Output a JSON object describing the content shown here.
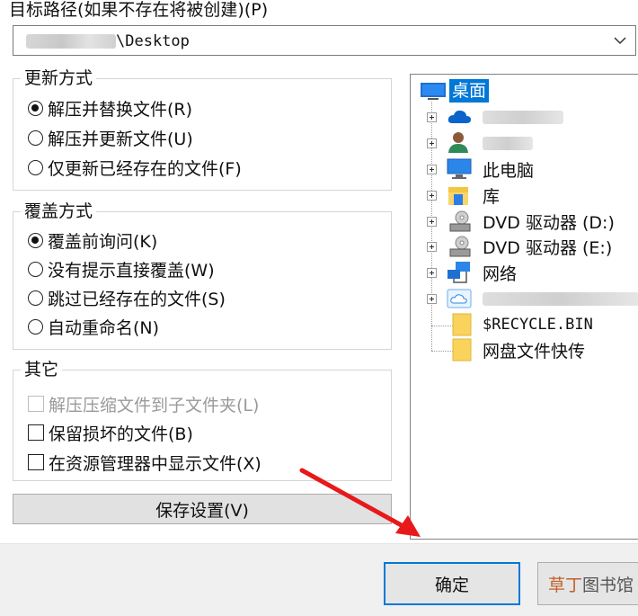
{
  "dialog": {
    "dest_label": "目标路径(如果不存在将被创建)(P)",
    "dest_path_suffix": "\\Desktop"
  },
  "update_group": {
    "title": "更新方式",
    "options": [
      {
        "label": "解压并替换文件(R)",
        "selected": true
      },
      {
        "label": "解压并更新文件(U)",
        "selected": false
      },
      {
        "label": "仅更新已经存在的文件(F)",
        "selected": false
      }
    ]
  },
  "overwrite_group": {
    "title": "覆盖方式",
    "options": [
      {
        "label": "覆盖前询问(K)",
        "selected": true
      },
      {
        "label": "没有提示直接覆盖(W)",
        "selected": false
      },
      {
        "label": "跳过已经存在的文件(S)",
        "selected": false
      },
      {
        "label": "自动重命名(N)",
        "selected": false
      }
    ]
  },
  "misc_group": {
    "title": "其它",
    "options": [
      {
        "label": "解压压缩文件到子文件夹(L)",
        "checked": false,
        "disabled": true
      },
      {
        "label": "保留损坏的文件(B)",
        "checked": false,
        "disabled": false
      },
      {
        "label": "在资源管理器中显示文件(X)",
        "checked": false,
        "disabled": false
      }
    ]
  },
  "save_settings_label": "保存设置(V)",
  "tree": {
    "root": {
      "label": "桌面",
      "icon": "desktop-icon"
    },
    "items": [
      {
        "label": "",
        "icon": "onedrive-cloud-icon",
        "expandable": true
      },
      {
        "label": "",
        "icon": "user-icon",
        "expandable": true
      },
      {
        "label": "此电脑",
        "icon": "computer-icon",
        "expandable": true
      },
      {
        "label": "库",
        "icon": "library-icon",
        "expandable": true
      },
      {
        "label": "DVD 驱动器 (D:)",
        "icon": "dvd-drive-icon",
        "expandable": true
      },
      {
        "label": "DVD 驱动器 (E:)",
        "icon": "dvd-drive-icon",
        "expandable": true
      },
      {
        "label": "网络",
        "icon": "network-icon",
        "expandable": true
      },
      {
        "label": "",
        "icon": "icloud-drive-icon",
        "expandable": true
      },
      {
        "label": "$RECYCLE.BIN",
        "icon": "folder-icon",
        "expandable": false
      },
      {
        "label": "网盘文件快传",
        "icon": "folder-icon",
        "expandable": false
      }
    ]
  },
  "buttons": {
    "ok": "确定",
    "cancel": ""
  },
  "watermark": {
    "part1": "草丁",
    "part2": "图书馆"
  },
  "colors": {
    "accent": "#0078d7",
    "selection": "#0078d7",
    "annotation_arrow": "#e8191a"
  }
}
